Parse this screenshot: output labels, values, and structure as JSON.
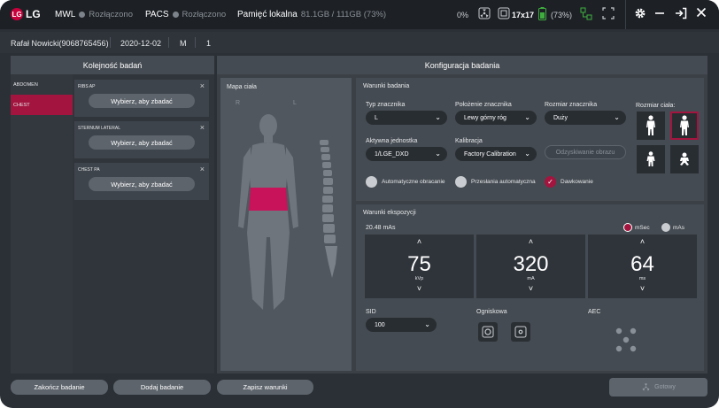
{
  "topbar": {
    "logo_text": "LG",
    "logo_mark": "LG",
    "mwl_label": "MWL",
    "mwl_status": "Rozłączono",
    "pacs_label": "PACS",
    "pacs_status": "Rozłączono",
    "memory_label": "Pamięć lokalna",
    "memory_value": "81.1GB / 111GB (73%)",
    "percent": "0%",
    "detector_size": "17x17",
    "battery": "(73%)"
  },
  "patient": {
    "name": "Rafał Nowicki(9068765456)",
    "date": "2020-12-02",
    "sex": "M",
    "number": "1"
  },
  "left_panel": {
    "title": "Kolejność badań",
    "nav": [
      {
        "label": "ABDOMEN",
        "active": false
      },
      {
        "label": "CHEST",
        "active": true
      }
    ],
    "cards": [
      {
        "title": "RIBS AP",
        "button": "Wybierz, aby zbadać"
      },
      {
        "title": "STERNUM LATERAL",
        "button": "Wybierz, aby zbadać"
      },
      {
        "title": "CHEST PA",
        "button": "Wybierz, aby zbadać"
      }
    ],
    "close_glyph": "×"
  },
  "right_panel": {
    "title": "Konfiguracja badania",
    "body_map": {
      "title": "Mapa ciała",
      "r": "R",
      "l": "L"
    },
    "conditions": {
      "title": "Warunki badania",
      "marker_type_label": "Typ znacznika",
      "marker_type_value": "L",
      "marker_pos_label": "Położenie znacznika",
      "marker_pos_value": "Lewy górny róg",
      "marker_size_label": "Rozmiar znacznika",
      "marker_size_value": "Duży",
      "body_size_label": "Rozmiar ciała:",
      "unit_label": "Aktywna jednostka",
      "unit_value": "1/LGE_DXD",
      "calib_label": "Kalibracja",
      "calib_value": "Factory Calibration",
      "recover_label": "Odzyskiwanie obrazu",
      "auto_rotate": "Automatyczne obracanie",
      "auto_send": "Przesłania automatyczna",
      "dosing": "Dawkowanie",
      "check_glyph": "✓",
      "chevron": "⌄"
    },
    "exposure": {
      "title": "Warunki ekspozycji",
      "mas_value": "20.48 mAs",
      "msec_label": "mSec",
      "mas_label": "mAs",
      "kvp": {
        "value": "75",
        "unit": "kVp"
      },
      "ma": {
        "value": "320",
        "unit": "mA"
      },
      "ms": {
        "value": "64",
        "unit": "ms"
      },
      "up_glyph": "˄",
      "down_glyph": "˅",
      "sid_label": "SID",
      "sid_value": "100",
      "focus_label": "Ogniskowa",
      "aec_label": "AEC"
    }
  },
  "bottom": {
    "end_exam": "Zakończ badanie",
    "add_exam": "Dodaj badanie",
    "save_conditions": "Zapisz warunki",
    "ready": "Gotowy"
  },
  "colors": {
    "accent": "#a3153f",
    "background": "#2b3036",
    "topbar": "#1d2126"
  }
}
